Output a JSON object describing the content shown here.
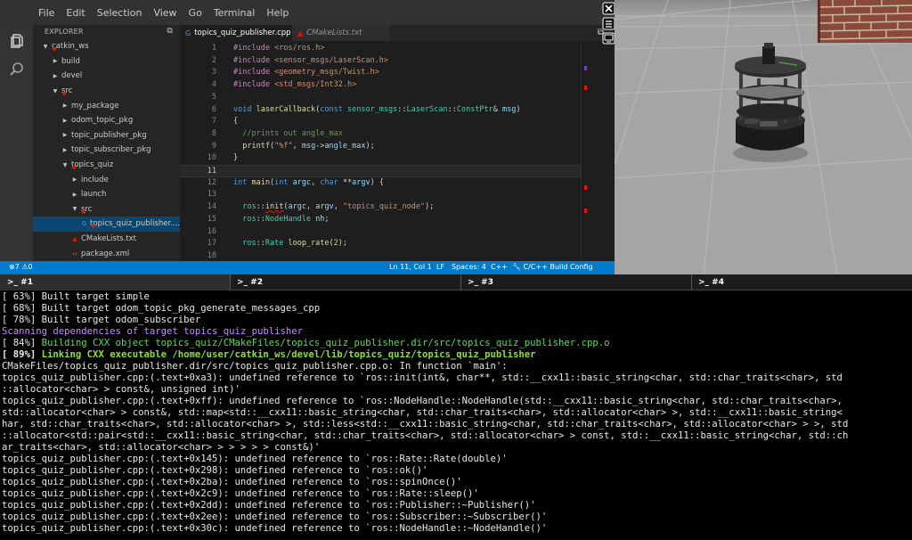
{
  "menu": [
    "File",
    "Edit",
    "Selection",
    "View",
    "Go",
    "Terminal",
    "Help"
  ],
  "explorer": {
    "title": "EXPLORER",
    "tree": [
      {
        "label": "catkin_ws",
        "type": "folder",
        "open": true,
        "depth": 0,
        "error": true
      },
      {
        "label": "build",
        "type": "folder",
        "open": false,
        "depth": 1,
        "error": false
      },
      {
        "label": "devel",
        "type": "folder",
        "open": false,
        "depth": 1,
        "error": false
      },
      {
        "label": "src",
        "type": "folder",
        "open": true,
        "depth": 1,
        "error": true
      },
      {
        "label": "my_package",
        "type": "folder",
        "open": false,
        "depth": 2,
        "error": false
      },
      {
        "label": "odom_topic_pkg",
        "type": "folder",
        "open": false,
        "depth": 2,
        "error": false
      },
      {
        "label": "topic_publisher_pkg",
        "type": "folder",
        "open": false,
        "depth": 2,
        "error": false
      },
      {
        "label": "topic_subscriber_pkg",
        "type": "folder",
        "open": false,
        "depth": 2,
        "error": false
      },
      {
        "label": "topics_quiz",
        "type": "folder",
        "open": true,
        "depth": 2,
        "error": true
      },
      {
        "label": "include",
        "type": "folder",
        "open": false,
        "depth": 3,
        "error": false
      },
      {
        "label": "launch",
        "type": "folder",
        "open": false,
        "depth": 3,
        "error": false
      },
      {
        "label": "src",
        "type": "folder",
        "open": true,
        "depth": 3,
        "error": true
      },
      {
        "label": "topics_quiz_publisher....",
        "type": "cpp",
        "depth": 4,
        "error": true,
        "selected": true
      },
      {
        "label": "CMakeLists.txt",
        "type": "cmake",
        "depth": 3,
        "error": false
      },
      {
        "label": "package.xml",
        "type": "xml",
        "depth": 3,
        "error": false
      }
    ]
  },
  "tabs": [
    {
      "label": "topics_quiz_publisher.cpp",
      "active": true
    },
    {
      "label": "CMakeLists.txt",
      "active": false
    }
  ],
  "code_lines": [
    {
      "n": "1",
      "html": "<span class='c-inc'>#include</span> <span class='c-str'>&lt;ros/ros.h&gt;</span>"
    },
    {
      "n": "2",
      "html": "<span class='c-inc'>#include</span> <span class='c-str'>&lt;sensor_msgs/LaserScan.h&gt;</span>"
    },
    {
      "n": "3",
      "html": "<span class='c-inc'>#include</span> <span class='c-str'>&lt;geometry_msgs/Twist.h&gt;</span>"
    },
    {
      "n": "4",
      "html": "<span class='c-inc'>#include</span> <span class='c-str'>&lt;std_msgs/Int32.h&gt;</span>"
    },
    {
      "n": "5",
      "html": ""
    },
    {
      "n": "6",
      "html": "<span class='c-kw'>void</span> <span class='c-fn'>laserCallback</span><span class='c-def'>(</span><span class='c-kw'>const</span> <span class='c-cls'>sensor_msgs</span><span class='c-def'>::</span><span class='c-cls'>LaserScan</span><span class='c-def'>::</span><span class='c-cls'>ConstPtr</span><span class='c-def'>&amp; </span><span class='c-var'>msg</span><span class='c-def'>)</span>"
    },
    {
      "n": "7",
      "html": "<span class='c-def'>{</span>"
    },
    {
      "n": "8",
      "html": "  <span class='c-cm'>//prints out angle_max</span>"
    },
    {
      "n": "9",
      "html": "  <span class='c-fn'>printf</span><span class='c-def'>(</span><span class='c-str'>\"%f\"</span><span class='c-def'>, </span><span class='c-var'>msg</span><span class='c-def'>-&gt;</span><span class='c-var'>angle_max</span><span class='c-def'>);</span>"
    },
    {
      "n": "10",
      "html": "<span class='c-def'>}</span>"
    },
    {
      "n": "11",
      "html": "",
      "current": true
    },
    {
      "n": "12",
      "html": "<span class='c-kw'>int</span> <span class='c-fn'>main</span><span class='c-def'>(</span><span class='c-kw'>int</span> <span class='c-var'>argc</span><span class='c-def'>, </span><span class='c-kw'>char</span> <span class='c-def'>**</span><span class='c-var'>argv</span><span class='c-def'>) {</span>"
    },
    {
      "n": "13",
      "html": ""
    },
    {
      "n": "14",
      "html": "  <span class='c-cls'>ros</span><span class='c-def'>::</span><span class='c-fn squig'>init</span><span class='c-def'>(</span><span class='c-var'>argc</span><span class='c-def'>, </span><span class='c-var'>argv</span><span class='c-def'>, </span><span class='c-str'>\"topics_quiz_node\"</span><span class='c-def'>);</span>"
    },
    {
      "n": "15",
      "html": "  <span class='c-cls'>ros</span><span class='c-def'>::</span><span class='c-cls'>NodeHandle</span> <span class='c-var'>nh</span><span class='c-def'>;</span>"
    },
    {
      "n": "16",
      "html": ""
    },
    {
      "n": "17",
      "html": "  <span class='c-cls'>ros</span><span class='c-def'>::</span><span class='c-cls'>Rate</span> <span class='c-fn'>loop_rate</span><span class='c-def'>(</span><span class='c-num'>2</span><span class='c-def'>);</span>"
    },
    {
      "n": "18",
      "html": ""
    }
  ],
  "status": {
    "errors": "7",
    "warnings": "0",
    "position": "Ln 11, Col 1",
    "eol": "LF",
    "spaces": "Spaces: 4",
    "lang": "C++",
    "config": "C/C++ Build Config"
  },
  "terminal_tabs": [
    ">_ #1",
    ">_ #2",
    ">_ #3",
    ">_ #4"
  ],
  "terminal_lines": [
    {
      "style": "",
      "text": "[ 63%] Built target simple"
    },
    {
      "style": "",
      "text": "[ 68%] Built target odom_topic_pkg_generate_messages_cpp"
    },
    {
      "style": "",
      "text": "[ 78%] Built target odom_subscriber"
    },
    {
      "style": "magenta",
      "text": "Scanning dependencies of target topics_quiz_publisher"
    },
    {
      "style": "green",
      "prefix": "[ 84%] ",
      "text": "Building CXX object topics_quiz/CMakeFiles/topics_quiz_publisher.dir/src/topics_quiz_publisher.cpp.o"
    },
    {
      "style": "boldgreen",
      "prefix": "[ 89%] ",
      "text": "Linking CXX executable /home/user/catkin_ws/devel/lib/topics_quiz/topics_quiz_publisher"
    },
    {
      "style": "",
      "text": "CMakeFiles/topics_quiz_publisher.dir/src/topics_quiz_publisher.cpp.o: In function `main':"
    },
    {
      "style": "",
      "text": "topics_quiz_publisher.cpp:(.text+0xa3): undefined reference to `ros::init(int&, char**, std::__cxx11::basic_string<char, std::char_traits<char>, std"
    },
    {
      "style": "",
      "text": "::allocator<char> > const&, unsigned int)'"
    },
    {
      "style": "",
      "text": "topics_quiz_publisher.cpp:(.text+0xff): undefined reference to `ros::NodeHandle::NodeHandle(std::__cxx11::basic_string<char, std::char_traits<char>,"
    },
    {
      "style": "",
      "text": "std::allocator<char> > const&, std::map<std::__cxx11::basic_string<char, std::char_traits<char>, std::allocator<char> >, std::__cxx11::basic_string<"
    },
    {
      "style": "",
      "text": "har, std::char_traits<char>, std::allocator<char> >, std::less<std::__cxx11::basic_string<char, std::char_traits<char>, std::allocator<char> > >, std"
    },
    {
      "style": "",
      "text": "::allocator<std::pair<std::__cxx11::basic_string<char, std::char_traits<char>, std::allocator<char> > const, std::__cxx11::basic_string<char, std::ch"
    },
    {
      "style": "",
      "text": "ar_traits<char>, std::allocator<char> > > > > > const&)'"
    },
    {
      "style": "",
      "text": "topics_quiz_publisher.cpp:(.text+0x145): undefined reference to `ros::Rate::Rate(double)'"
    },
    {
      "style": "",
      "text": "topics_quiz_publisher.cpp:(.text+0x298): undefined reference to `ros::ok()'"
    },
    {
      "style": "",
      "text": "topics_quiz_publisher.cpp:(.text+0x2ba): undefined reference to `ros::spinOnce()'"
    },
    {
      "style": "",
      "text": "topics_quiz_publisher.cpp:(.text+0x2c9): undefined reference to `ros::Rate::sleep()'"
    },
    {
      "style": "",
      "text": "topics_quiz_publisher.cpp:(.text+0x2dd): undefined reference to `ros::Publisher::~Publisher()'"
    },
    {
      "style": "",
      "text": "topics_quiz_publisher.cpp:(.text+0x2ee): undefined reference to `ros::Subscriber::~Subscriber()'"
    },
    {
      "style": "",
      "text": "topics_quiz_publisher.cpp:(.text+0x30c): undefined reference to `ros::NodeHandle::~NodeHandle()'"
    }
  ],
  "colors": {
    "statusbar": "#007acc",
    "error": "#e51400",
    "terminal_bg": "#000000"
  }
}
